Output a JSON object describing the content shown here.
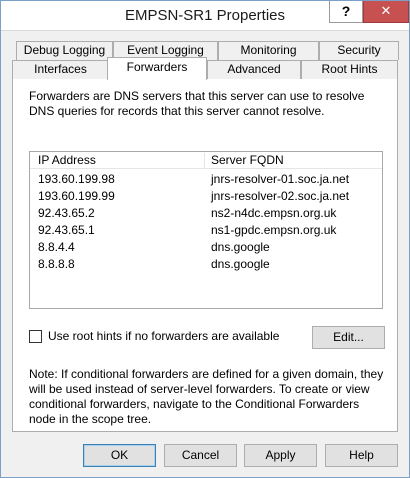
{
  "window": {
    "title": "EMPSN-SR1 Properties",
    "help_glyph": "?",
    "close_glyph": "✕"
  },
  "tabs": {
    "top_row": [
      "Debug Logging",
      "Event Logging",
      "Monitoring",
      "Security"
    ],
    "bottom_row": [
      "Interfaces",
      "Forwarders",
      "Advanced",
      "Root Hints"
    ],
    "active": "Forwarders"
  },
  "forwarders": {
    "description": "Forwarders are DNS servers that this server can use to resolve DNS queries for records that this server cannot resolve.",
    "columns": [
      "IP Address",
      "Server FQDN"
    ],
    "rows": [
      {
        "ip": "193.60.199.98",
        "fqdn": "jnrs-resolver-01.soc.ja.net"
      },
      {
        "ip": "193.60.199.99",
        "fqdn": "jnrs-resolver-02.soc.ja.net"
      },
      {
        "ip": "92.43.65.2",
        "fqdn": "ns2-n4dc.empsn.org.uk"
      },
      {
        "ip": "92.43.65.1",
        "fqdn": "ns1-gpdc.empsn.org.uk"
      },
      {
        "ip": "8.8.4.4",
        "fqdn": "dns.google"
      },
      {
        "ip": "8.8.8.8",
        "fqdn": "dns.google"
      }
    ],
    "use_root_hints_label": "Use root hints if no forwarders are available",
    "use_root_hints_checked": false,
    "edit_label": "Edit...",
    "note": "Note: If conditional forwarders are defined for a given domain, they will be used instead of server-level forwarders.  To create or view conditional forwarders, navigate to the Conditional Forwarders node in the scope tree."
  },
  "buttons": {
    "ok": "OK",
    "cancel": "Cancel",
    "apply": "Apply",
    "help": "Help"
  }
}
